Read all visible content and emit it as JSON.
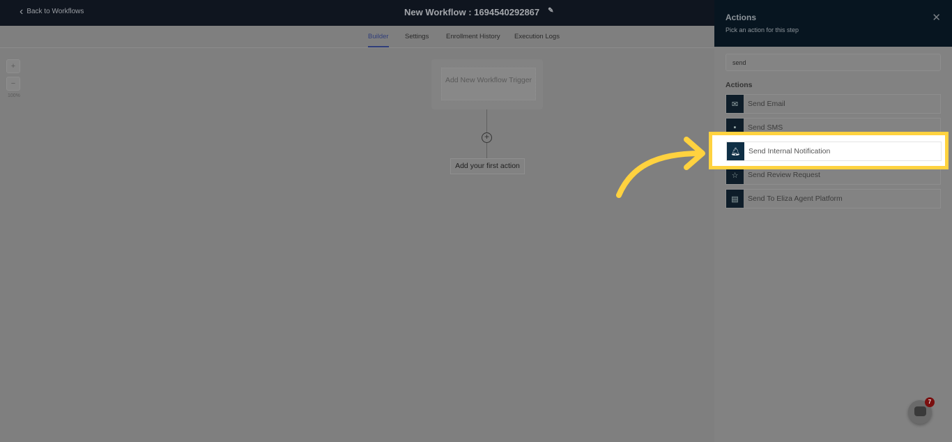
{
  "header": {
    "back_label": "Back to Workflows",
    "title": "New Workflow : 1694540292867"
  },
  "tabs": [
    {
      "label": "Builder",
      "active": true
    },
    {
      "label": "Settings"
    },
    {
      "label": "Enrollment History"
    },
    {
      "label": "Execution Logs"
    }
  ],
  "canvas": {
    "zoom_in": "+",
    "zoom_out": "−",
    "zoom_level": "100%",
    "trigger_label": "Add New Workflow Trigger",
    "add_step": "+",
    "first_action": "Add your first action"
  },
  "panel": {
    "title": "Actions",
    "subtitle": "Pick an action for this step",
    "close": "✕",
    "search_value": "send",
    "section": "Actions",
    "items": [
      {
        "label": "Send Email",
        "icon": "envelope-open-icon"
      },
      {
        "label": "Send SMS",
        "icon": "sms-icon"
      },
      {
        "label": "Send Internal Notification",
        "icon": "bell-icon",
        "highlighted": true
      },
      {
        "label": "Send Review Request",
        "icon": "star-list-icon"
      },
      {
        "label": "Send To Eliza Agent Platform",
        "icon": "chat-icon"
      }
    ]
  },
  "chat_widget": {
    "badge": "7"
  },
  "colors": {
    "highlight": "#ffd23f",
    "header": "#0f151f"
  }
}
